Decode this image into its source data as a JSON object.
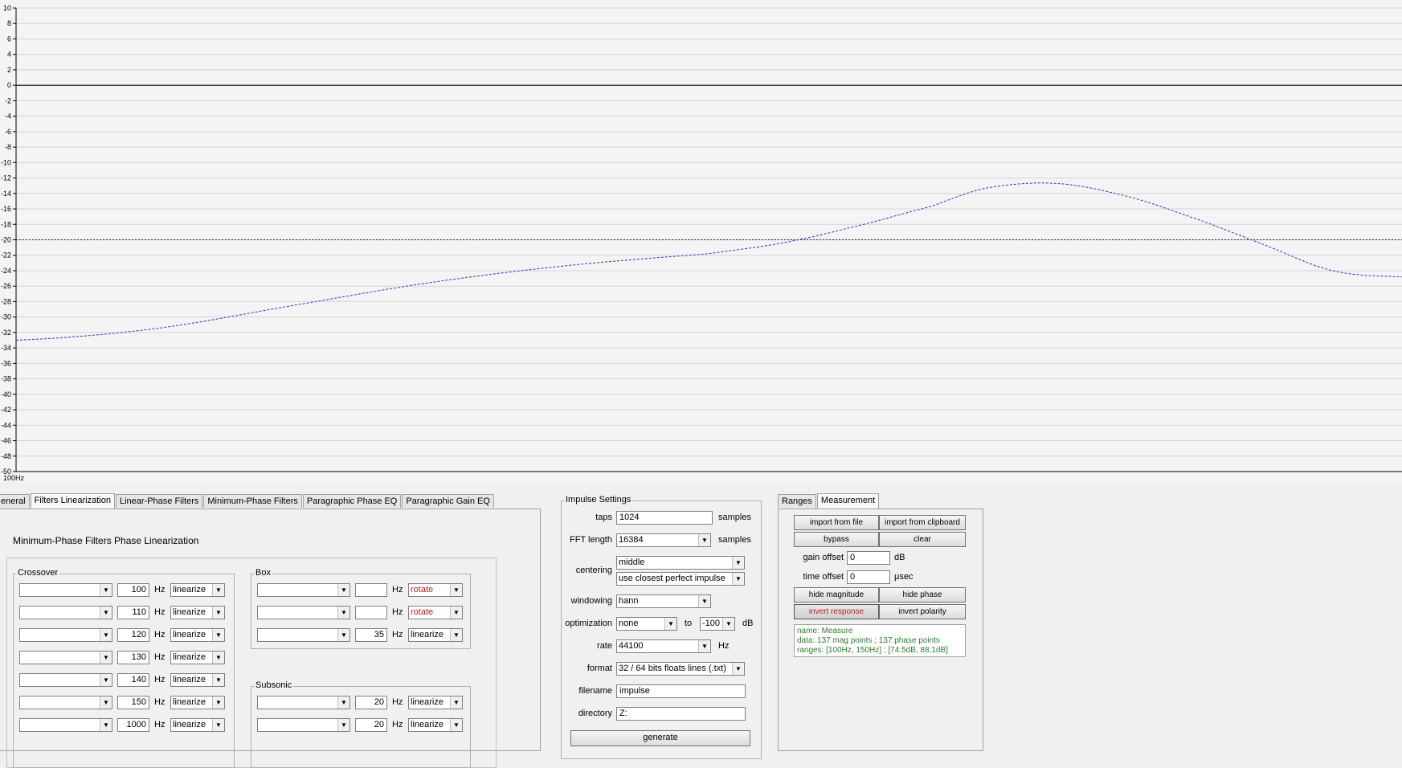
{
  "chart_data": {
    "type": "line",
    "ylim": [
      -50,
      10
    ],
    "ytick_labels": [
      "10",
      "8",
      "6",
      "4",
      "2",
      "0",
      "-2",
      "-4",
      "-6",
      "-8",
      "-10",
      "-12",
      "-14",
      "-16",
      "-18",
      "-20",
      "-22",
      "-24",
      "-26",
      "-28",
      "-30",
      "-32",
      "-34",
      "-36",
      "-38",
      "-40",
      "-42",
      "-44",
      "-46",
      "-48",
      "-50"
    ],
    "xtick_label": "100Hz",
    "zero_line": 0,
    "reference_line": -20,
    "series": [
      {
        "color": "#1f3fbf",
        "style": "dashed",
        "x": [
          0,
          0.1,
          0.2,
          0.3,
          0.4,
          0.5,
          0.55,
          0.6,
          0.66,
          0.7,
          0.75,
          0.8,
          0.85,
          0.9,
          0.95,
          1.0
        ],
        "y": [
          -33,
          -31.5,
          -28.5,
          -25.5,
          -23.3,
          -21.8,
          -20.5,
          -18.5,
          -15.7,
          -13.3,
          -12.7,
          -14.3,
          -17.2,
          -20.6,
          -24,
          -24.8
        ]
      }
    ],
    "grid": true
  },
  "tabs": [
    "eneral",
    "Filters Linearization",
    "Linear-Phase Filters",
    "Minimum-Phase Filters",
    "Paragraphic Phase EQ",
    "Paragraphic Gain EQ"
  ],
  "active_tab": 1,
  "filters": {
    "heading": "Minimum-Phase Filters Phase Linearization",
    "crossover_label": "Crossover",
    "box_label": "Box",
    "subsonic_label": "Subsonic",
    "hz": "Hz",
    "crossover_rows": [
      {
        "freq": "100",
        "mode": "linearize"
      },
      {
        "freq": "110",
        "mode": "linearize"
      },
      {
        "freq": "120",
        "mode": "linearize"
      },
      {
        "freq": "130",
        "mode": "linearize"
      },
      {
        "freq": "140",
        "mode": "linearize"
      },
      {
        "freq": "150",
        "mode": "linearize"
      },
      {
        "freq": "1000",
        "mode": "linearize"
      }
    ],
    "box_rows": [
      {
        "freq": "",
        "mode": "rotate"
      },
      {
        "freq": "",
        "mode": "rotate"
      },
      {
        "freq": "35",
        "mode": "linearize"
      }
    ],
    "subsonic_rows": [
      {
        "freq": "20",
        "mode": "linearize"
      },
      {
        "freq": "20",
        "mode": "linearize"
      }
    ]
  },
  "impulse": {
    "title": "Impulse Settings",
    "taps_label": "taps",
    "taps": "1024",
    "taps_unit": "samples",
    "fft_label": "FFT length",
    "fft": "16384",
    "fft_unit": "samples",
    "centering_label": "centering",
    "centering": "middle",
    "centering2": "use closest perfect impulse",
    "windowing_label": "windowing",
    "windowing": "hann",
    "optimization_label": "optimization",
    "optimization": "none",
    "to_label": "to",
    "optimization_to": "-100",
    "db": "dB",
    "rate_label": "rate",
    "rate": "44100",
    "rate_unit": "Hz",
    "format_label": "format",
    "format": "32 / 64 bits floats lines (.txt)",
    "filename_label": "filename",
    "filename": "impulse",
    "directory_label": "directory",
    "directory": "Z:",
    "generate": "generate"
  },
  "measurement": {
    "tabs": [
      "Ranges",
      "Measurement"
    ],
    "active_tab": 1,
    "import_file": "import from file",
    "import_clipboard": "import from clipboard",
    "bypass": "bypass",
    "clear": "clear",
    "gain_label": "gain offset",
    "gain": "0",
    "gain_unit": "dB",
    "time_label": "time offset",
    "time": "0",
    "time_unit": "µsec",
    "hide_magnitude": "hide magnitude",
    "hide_phase": "hide phase",
    "invert_response": "invert response",
    "invert_polarity": "invert polarity",
    "info": [
      "name: Measure",
      "data: 137 mag points ; 137 phase points",
      "ranges: [100Hz, 150Hz] ; [74.5dB, 88.1dB]"
    ]
  }
}
